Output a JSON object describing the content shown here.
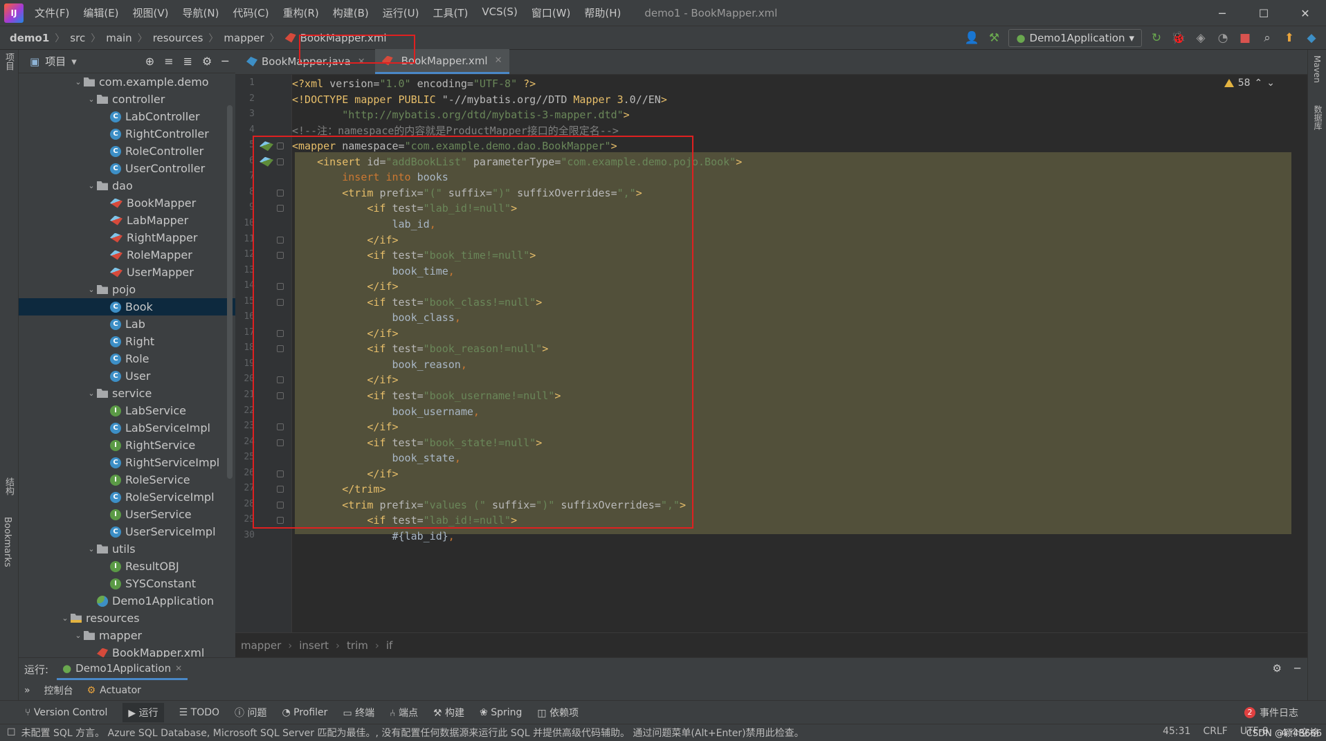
{
  "window": {
    "title": "demo1 - BookMapper.xml",
    "menus": [
      "文件(F)",
      "编辑(E)",
      "视图(V)",
      "导航(N)",
      "代码(C)",
      "重构(R)",
      "构建(B)",
      "运行(U)",
      "工具(T)",
      "VCS(S)",
      "窗口(W)",
      "帮助(H)"
    ]
  },
  "breadcrumb": [
    "demo1",
    "src",
    "main",
    "resources",
    "mapper",
    "BookMapper.xml"
  ],
  "run_config": "Demo1Application",
  "project_panel": {
    "title": "项目",
    "tree": [
      {
        "label": "com.example.demo",
        "kind": "package",
        "depth": 0,
        "open": true
      },
      {
        "label": "controller",
        "kind": "folder",
        "depth": 1,
        "open": true
      },
      {
        "label": "LabController",
        "kind": "class",
        "depth": 2
      },
      {
        "label": "RightController",
        "kind": "class",
        "depth": 2
      },
      {
        "label": "RoleController",
        "kind": "class",
        "depth": 2
      },
      {
        "label": "UserController",
        "kind": "class",
        "depth": 2
      },
      {
        "label": "dao",
        "kind": "folder",
        "depth": 1,
        "open": true
      },
      {
        "label": "BookMapper",
        "kind": "mapper",
        "depth": 2
      },
      {
        "label": "LabMapper",
        "kind": "mapper",
        "depth": 2
      },
      {
        "label": "RightMapper",
        "kind": "mapper",
        "depth": 2
      },
      {
        "label": "RoleMapper",
        "kind": "mapper",
        "depth": 2
      },
      {
        "label": "UserMapper",
        "kind": "mapper",
        "depth": 2
      },
      {
        "label": "pojo",
        "kind": "folder",
        "depth": 1,
        "open": true
      },
      {
        "label": "Book",
        "kind": "class",
        "depth": 2,
        "selected": true
      },
      {
        "label": "Lab",
        "kind": "class",
        "depth": 2
      },
      {
        "label": "Right",
        "kind": "class",
        "depth": 2
      },
      {
        "label": "Role",
        "kind": "class",
        "depth": 2
      },
      {
        "label": "User",
        "kind": "class",
        "depth": 2
      },
      {
        "label": "service",
        "kind": "folder",
        "depth": 1,
        "open": true
      },
      {
        "label": "LabService",
        "kind": "interface",
        "depth": 2
      },
      {
        "label": "LabServiceImpl",
        "kind": "class",
        "depth": 2
      },
      {
        "label": "RightService",
        "kind": "interface",
        "depth": 2
      },
      {
        "label": "RightServiceImpl",
        "kind": "class",
        "depth": 2
      },
      {
        "label": "RoleService",
        "kind": "interface",
        "depth": 2
      },
      {
        "label": "RoleServiceImpl",
        "kind": "class",
        "depth": 2
      },
      {
        "label": "UserService",
        "kind": "interface",
        "depth": 2
      },
      {
        "label": "UserServiceImpl",
        "kind": "class",
        "depth": 2
      },
      {
        "label": "utils",
        "kind": "folder",
        "depth": 1,
        "open": true
      },
      {
        "label": "ResultOBJ",
        "kind": "interface",
        "depth": 2
      },
      {
        "label": "SYSConstant",
        "kind": "interface",
        "depth": 2
      },
      {
        "label": "Demo1Application",
        "kind": "app",
        "depth": 1
      },
      {
        "label": "resources",
        "kind": "resfolder",
        "depth": -1,
        "open": true
      },
      {
        "label": "mapper",
        "kind": "folder",
        "depth": 0,
        "open": true
      },
      {
        "label": "BookMapper.xml",
        "kind": "xml",
        "depth": 1
      }
    ]
  },
  "tabs": [
    {
      "label": "BookMapper.java",
      "active": false
    },
    {
      "label": "BookMapper.xml",
      "active": true
    }
  ],
  "warnings_count": "58",
  "code_lines": [
    "<?xml version=\"1.0\" encoding=\"UTF-8\" ?>",
    "<!DOCTYPE mapper PUBLIC \"-//mybatis.org//DTD Mapper 3.0//EN\"",
    "        \"http://mybatis.org/dtd/mybatis-3-mapper.dtd\">",
    "<!--注：namespace的内容就是ProductMapper接口的全限定名-->",
    "<mapper namespace=\"com.example.demo.dao.BookMapper\">",
    "    <insert id=\"addBookList\" parameterType=\"com.example.demo.pojo.Book\">",
    "        insert into books",
    "        <trim prefix=\"(\" suffix=\")\" suffixOverrides=\",\">",
    "            <if test=\"lab_id!=null\">",
    "                lab_id,",
    "            </if>",
    "            <if test=\"book_time!=null\">",
    "                book_time,",
    "            </if>",
    "            <if test=\"book_class!=null\">",
    "                book_class,",
    "            </if>",
    "            <if test=\"book_reason!=null\">",
    "                book_reason,",
    "            </if>",
    "            <if test=\"book_username!=null\">",
    "                book_username,",
    "            </if>",
    "            <if test=\"book_state!=null\">",
    "                book_state,",
    "            </if>",
    "        </trim>",
    "        <trim prefix=\"values (\" suffix=\")\" suffixOverrides=\",\">",
    "            <if test=\"lab_id!=null\">",
    "                #{lab_id},"
  ],
  "line_count_start": 1,
  "editor_breadcrumb": [
    "mapper",
    "insert",
    "trim",
    "if"
  ],
  "run_panel": {
    "label": "运行:",
    "tab": "Demo1Application",
    "sub": [
      "控制台",
      "Actuator"
    ]
  },
  "bottom_tools": [
    "Version Control",
    "运行",
    "TODO",
    "问题",
    "Profiler",
    "终端",
    "端点",
    "构建",
    "Spring",
    "依赖项"
  ],
  "event_log": {
    "count": "2",
    "label": "事件日志"
  },
  "left_strip": [
    "项目",
    "结构",
    "Bookmarks"
  ],
  "right_strip": [
    "Maven",
    "数据库"
  ],
  "status": {
    "message": "未配置 SQL 方言。 Azure SQL Database, Microsoft SQL Server 匹配为最佳。, 没有配置任何数据源来运行此 SQL 并提供高级代码辅助。 通过问题菜单(Alt+Enter)禁用此检查。",
    "position": "45:31",
    "line_sep": "CRLF",
    "encoding": "UTF-8",
    "indent": "4 个空格",
    "watermark": "CSDN @颖4B666"
  }
}
